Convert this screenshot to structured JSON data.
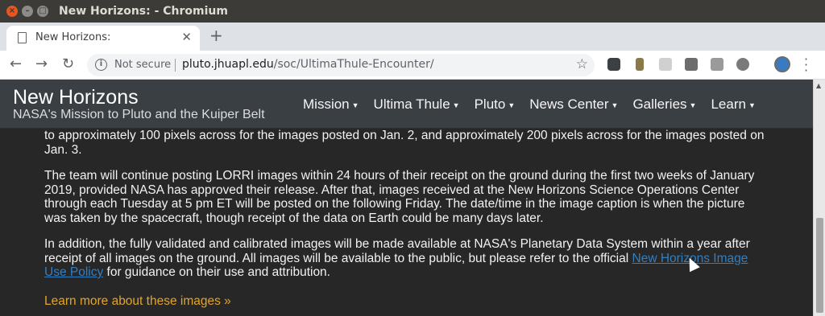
{
  "window": {
    "title": "New Horizons: - Chromium"
  },
  "tab": {
    "title": "New Horizons:",
    "close": "✕",
    "new": "+"
  },
  "toolbar": {
    "back": "←",
    "forward": "→",
    "reload": "↻",
    "security_label": "Not secure",
    "url_host": "pluto.jhuapl.edu",
    "url_path": "/soc/UltimaThule-Encounter/",
    "star": "☆"
  },
  "site": {
    "brand": "New Horizons",
    "subtitle": "NASA's Mission to Pluto and the Kuiper Belt",
    "menu": [
      "Mission",
      "Ultima Thule",
      "Pluto",
      "News Center",
      "Galleries",
      "Learn"
    ]
  },
  "content": {
    "p1": "to approximately 100 pixels across for the images posted on Jan. 2, and approximately 200 pixels across for the images posted on Jan. 3.",
    "p2": "The team will continue posting LORRI images within 24 hours of their receipt on the ground during the first two weeks of January 2019, provided NASA has approved their release. After that, images received at the New Horizons Science Operations Center through each Tuesday at 5 pm ET will be posted on the following Friday. The date/time in the image caption is when the picture was taken by the spacecraft, though receipt of the data on Earth could be many days later.",
    "p3_before": "In addition, the fully validated and calibrated images will be made available at NASA's Planetary Data System within a year after receipt of all images on the ground. All images will be available to the public, but please refer to the official ",
    "p3_link": "New Horizons Image Use Policy",
    "p3_after": " for guidance on their use and attribution.",
    "learn_more": "Learn more about these images »"
  },
  "colors": {
    "nav_bg": "#3a3f44",
    "content_bg": "#272727",
    "link": "#2f80c4",
    "accent_link": "#e2a52d"
  }
}
